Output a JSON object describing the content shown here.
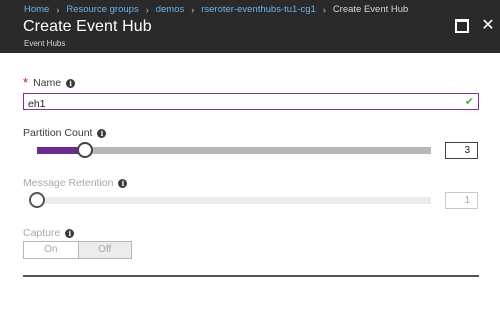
{
  "breadcrumb": [
    "Home",
    "Resource groups",
    "demos",
    "rseroter-eventhubs-tu1-cg1",
    "Create Event Hub"
  ],
  "header": {
    "title": "Create Event Hub",
    "subtitle": "Event Hubs"
  },
  "form": {
    "name": {
      "label": "Name",
      "required_mark": "*",
      "value": "eh1"
    },
    "partition_count": {
      "label": "Partition Count",
      "value": "3",
      "fraction": 0.08
    },
    "message_retention": {
      "label": "Message Retention",
      "value": "1",
      "fraction": 0.0,
      "disabled": true
    },
    "capture": {
      "label": "Capture",
      "on_label": "On",
      "off_label": "Off",
      "selected": "Off",
      "disabled": true
    }
  },
  "icons": {
    "info": "info-icon",
    "check": "checkmark-icon",
    "maximize": "maximize-icon",
    "close": "close-icon",
    "chevron": "chevron-right-icon"
  },
  "colors": {
    "header_bg": "#2a2a2a",
    "link": "#6cb3e8",
    "accent": "#8b2a9b",
    "slider_fill": "#6a2b93",
    "valid": "#57a64a",
    "required": "#c8102e"
  }
}
